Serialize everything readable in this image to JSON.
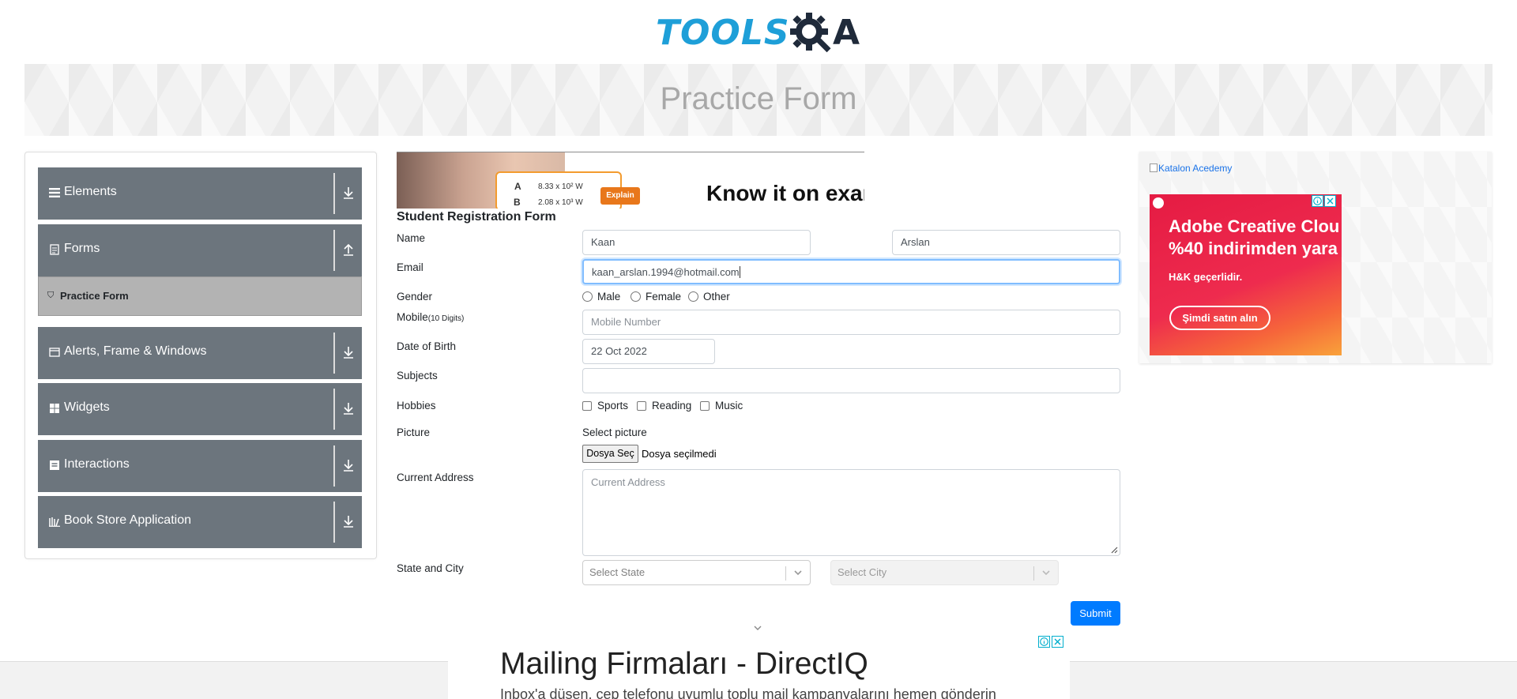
{
  "header": {
    "logo_text": "TOOLS",
    "logo_suffix": "A",
    "page_title": "Practice Form"
  },
  "sidebar": {
    "groups": [
      {
        "label": "Elements",
        "icon": "hamburger-icon"
      },
      {
        "label": "Forms",
        "icon": "form-icon",
        "expanded": true
      },
      {
        "label": "Alerts, Frame & Windows",
        "icon": "window-icon"
      },
      {
        "label": "Widgets",
        "icon": "grid-icon"
      },
      {
        "label": "Interactions",
        "icon": "interactions-icon"
      },
      {
        "label": "Book Store Application",
        "icon": "books-icon"
      }
    ],
    "active_item": "Practice Form"
  },
  "top_ad": {
    "row_a": "A",
    "value_a": "8.33 x 10² W",
    "row_b": "B",
    "value_b": "2.08 x 10³ W",
    "button": "Explain",
    "headline": "Know it on exar"
  },
  "form": {
    "title": "Student Registration Form",
    "labels": {
      "name": "Name",
      "email": "Email",
      "gender": "Gender",
      "mobile": "Mobile",
      "mobile_hint": "(10 Digits)",
      "dob": "Date of Birth",
      "subjects": "Subjects",
      "hobbies": "Hobbies",
      "picture": "Picture",
      "address": "Current Address",
      "state_city": "State and City"
    },
    "first_name": "Kaan",
    "last_name": "Arslan",
    "email": "kaan_arslan.1994@hotmail.com",
    "gender_options": [
      "Male",
      "Female",
      "Other"
    ],
    "mobile_placeholder": "Mobile Number",
    "dob": "22 Oct 2022",
    "subjects": "",
    "hobbies": [
      "Sports",
      "Reading",
      "Music"
    ],
    "picture_label": "Select picture",
    "file_button": "Dosya Seç",
    "file_status": "Dosya seçilmedi",
    "address_placeholder": "Current Address",
    "state_placeholder": "Select State",
    "city_placeholder": "Select City",
    "submit": "Submit"
  },
  "right_ad": {
    "broken_image_alt": "Katalon Acedemy",
    "line1": "Adobe Creative Clou",
    "line2": "%40 indirimden yara",
    "line3": "H&K geçerlidir.",
    "button": "Şimdi satın alın"
  },
  "bottom_ad": {
    "headline": "Mailing Firmaları - DirectIQ",
    "text": "Inbox'a düşen, cep telefonu uyumlu toplu mail kampanyalarını hemen gönderin"
  },
  "colors": {
    "sidebar_bg": "#6c757d",
    "active_item_bg": "#b3b3b3",
    "submit_bg": "#007bff",
    "logo_blue": "#1e9fd8"
  }
}
